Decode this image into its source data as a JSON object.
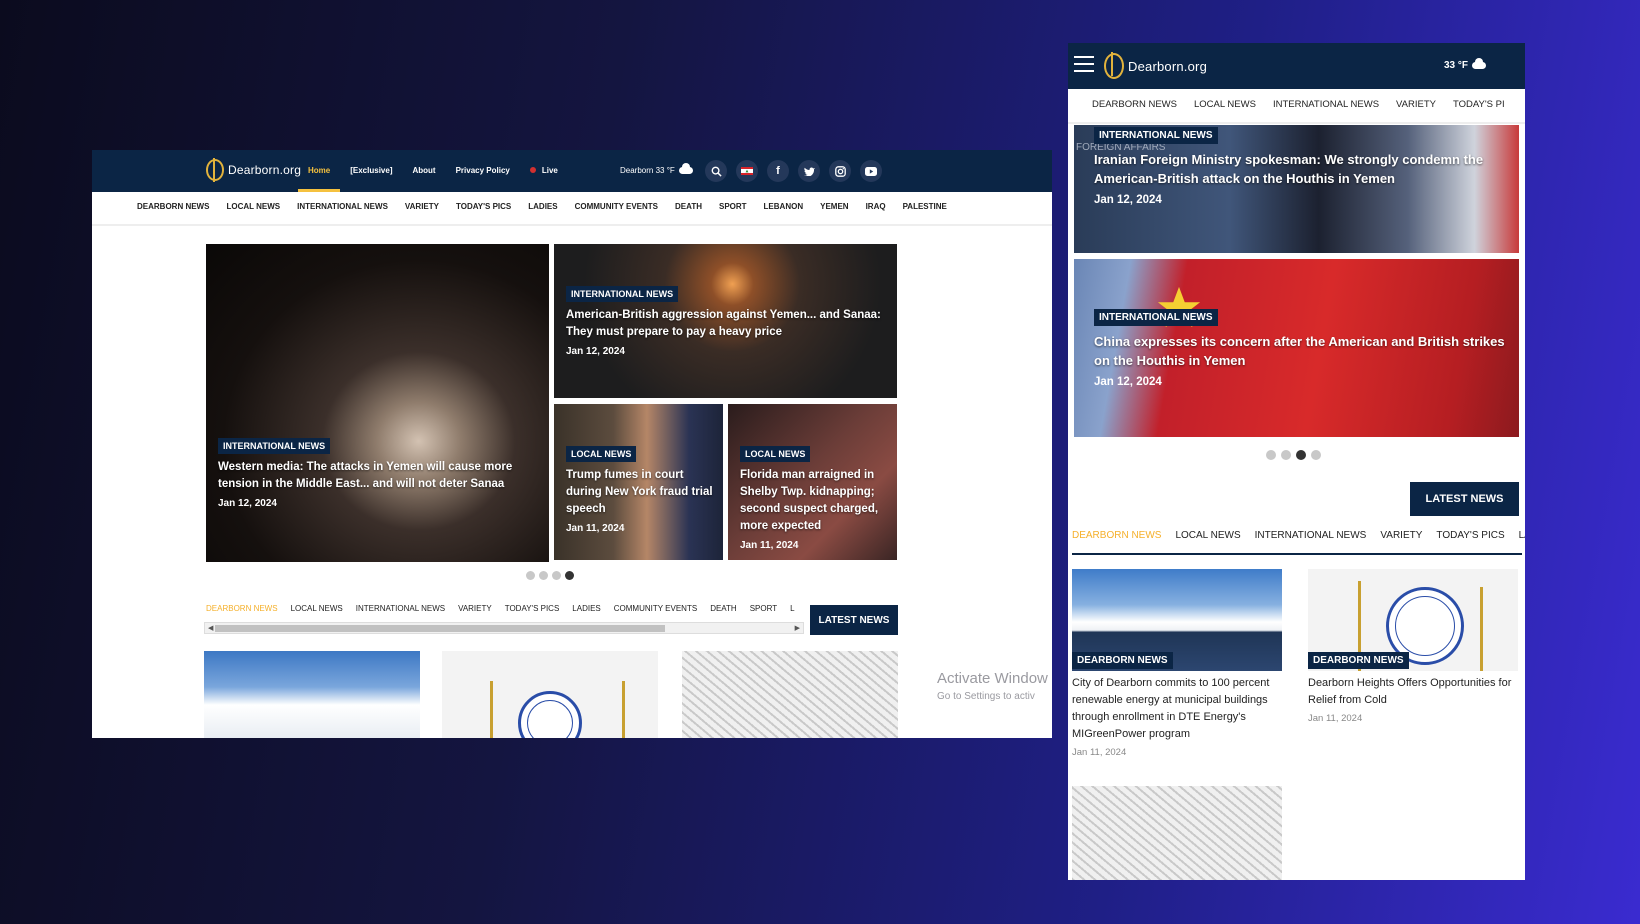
{
  "brand": {
    "name": "Dearborn.org"
  },
  "desktop": {
    "nav": [
      {
        "label": "Home",
        "active": true
      },
      {
        "label": "[Exclusive]"
      },
      {
        "label": "About"
      },
      {
        "label": "Privacy Policy"
      },
      {
        "label": "Live"
      }
    ],
    "weather": "Dearborn 33 °F",
    "social_icons": [
      "search-icon",
      "lebanon-flag-icon",
      "facebook-icon",
      "twitter-icon",
      "instagram-icon",
      "youtube-icon"
    ],
    "categories": [
      "DEARBORN NEWS",
      "LOCAL NEWS",
      "INTERNATIONAL NEWS",
      "VARIETY",
      "TODAY'S PICS",
      "LADIES",
      "COMMUNITY EVENTS",
      "DEATH",
      "SPORT",
      "LEBANON",
      "YEMEN",
      "IRAQ",
      "PALESTINE"
    ],
    "hero": {
      "main": {
        "tag": "INTERNATIONAL NEWS",
        "title": "Western media: The attacks in Yemen will cause more tension in the Middle East... and will not deter Sanaa",
        "date": "Jan 12, 2024"
      },
      "top_right": {
        "tag": "INTERNATIONAL NEWS",
        "title": "American-British aggression against Yemen... and Sanaa: They must prepare to pay a heavy price",
        "date": "Jan 12, 2024"
      },
      "bottom_left": {
        "tag": "LOCAL NEWS",
        "title": "Trump fumes in court during New York fraud trial speech",
        "date": "Jan 11, 2024"
      },
      "bottom_right": {
        "tag": "LOCAL NEWS",
        "title": "Florida man arraigned in Shelby Twp. kidnapping; second suspect charged, more expected",
        "date": "Jan 11, 2024"
      }
    },
    "slider": {
      "count": 4,
      "active_index": 3
    },
    "tabs": [
      "DEARBORN NEWS",
      "LOCAL NEWS",
      "INTERNATIONAL NEWS",
      "VARIETY",
      "TODAY'S PICS",
      "LADIES",
      "COMMUNITY EVENTS",
      "DEATH",
      "SPORT",
      "L"
    ],
    "active_tab": 0,
    "latest_label": "LATEST NEWS",
    "watermark": {
      "line1": "Activate Window",
      "line2": "Go to Settings to activ"
    }
  },
  "mobile": {
    "weather": "33 °F",
    "categories": [
      "DEARBORN NEWS",
      "LOCAL NEWS",
      "INTERNATIONAL NEWS",
      "VARIETY",
      "TODAY'S PI"
    ],
    "slide_top": {
      "tag": "INTERNATIONAL NEWS",
      "title": "Iranian Foreign Ministry spokesman: We strongly condemn the American-British attack on the Houthis in Yemen",
      "date": "Jan 12, 2024",
      "backdrop_text": "FOREIGN AFFAIRS"
    },
    "slide_bottom": {
      "tag": "INTERNATIONAL NEWS",
      "title": "China expresses its concern after the American and British strikes on the Houthis in Yemen",
      "date": "Jan 12, 2024"
    },
    "slider": {
      "count": 4,
      "active_index": 2
    },
    "latest_label": "LATEST NEWS",
    "tabs": [
      "DEARBORN NEWS",
      "LOCAL NEWS",
      "INTERNATIONAL NEWS",
      "VARIETY",
      "TODAY'S PICS",
      "LA"
    ],
    "active_tab": 0,
    "cards": [
      {
        "tag": "DEARBORN NEWS",
        "title": "City of Dearborn commits to 100 percent renewable energy at municipal buildings through enrollment in DTE Energy's MIGreenPower program",
        "date": "Jan 11, 2024"
      },
      {
        "tag": "DEARBORN NEWS",
        "title": "Dearborn Heights Offers Opportunities for Relief from Cold",
        "date": "Jan 11, 2024"
      }
    ]
  },
  "colors": {
    "navy": "#0b2545",
    "accent": "#f5c13f",
    "tab_active": "#f5b02b",
    "live": "#d13030"
  }
}
